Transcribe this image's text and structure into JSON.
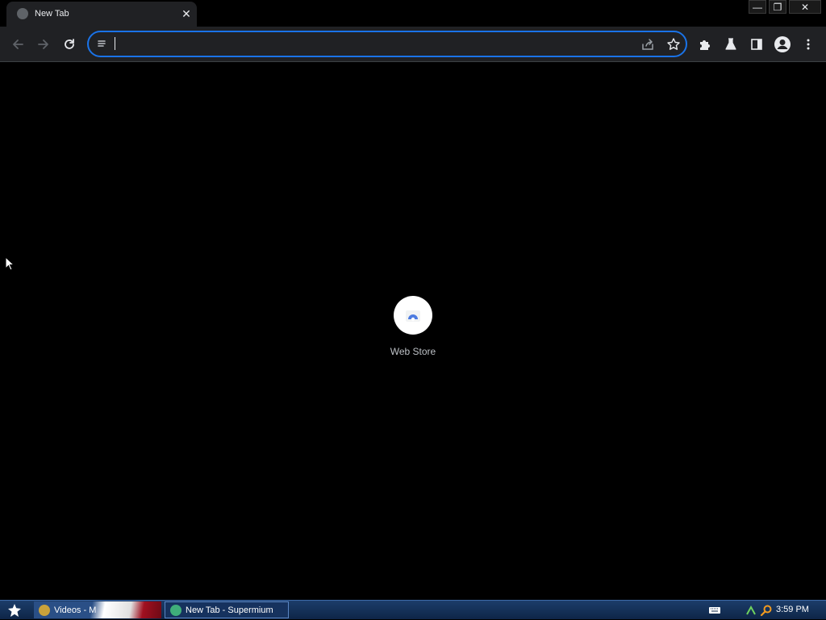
{
  "tab": {
    "title": "New Tab",
    "close_glyph": "✕"
  },
  "window_controls": {
    "minimize": "—",
    "restore": "❐",
    "close": "✕"
  },
  "toolbar": {
    "back_icon": "arrow-left-icon",
    "forward_icon": "arrow-right-icon",
    "reload_icon": "reload-icon",
    "omnibox_value": ""
  },
  "content": {
    "shortcut_label": "Web Store"
  },
  "taskbar": {
    "task1_label": "Videos - M",
    "task2_label": "New Tab - Supermium",
    "clock": "3:59 PM"
  },
  "colors": {
    "accent": "#1a73e8",
    "toolbar_bg": "#202124",
    "page_bg": "#000000",
    "taskbar": "#1c3d6a"
  }
}
